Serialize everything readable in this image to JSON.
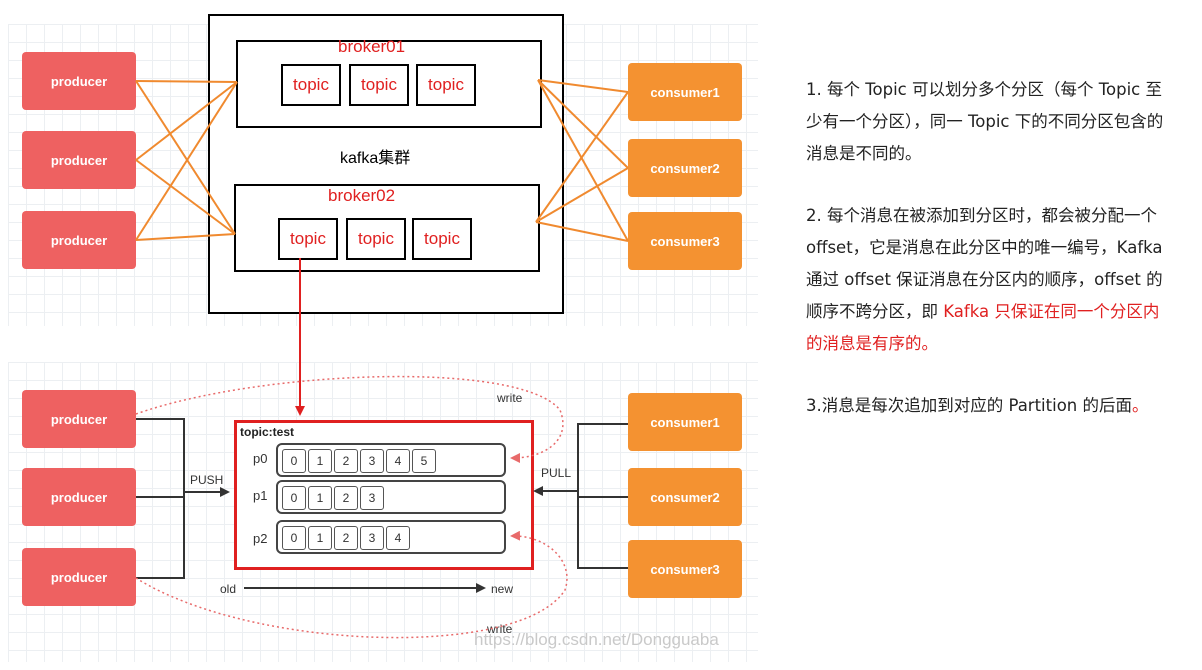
{
  "top": {
    "producers": [
      "producer",
      "producer",
      "producer"
    ],
    "consumers": [
      "consumer1",
      "consumer2",
      "consumer3"
    ],
    "cluster_label": "kafka集群",
    "brokers": [
      {
        "name": "broker01",
        "topics": [
          "topic",
          "topic",
          "topic"
        ]
      },
      {
        "name": "broker02",
        "topics": [
          "topic",
          "topic",
          "topic"
        ]
      }
    ]
  },
  "bottom": {
    "producers": [
      "producer",
      "producer",
      "producer"
    ],
    "consumers": [
      "consumer1",
      "consumer2",
      "consumer3"
    ],
    "topic_title": "topic:test",
    "partitions": [
      {
        "label": "p0",
        "offsets": [
          "0",
          "1",
          "2",
          "3",
          "4",
          "5"
        ]
      },
      {
        "label": "p1",
        "offsets": [
          "0",
          "1",
          "2",
          "3"
        ]
      },
      {
        "label": "p2",
        "offsets": [
          "0",
          "1",
          "2",
          "3",
          "4"
        ]
      }
    ],
    "push_label": "PUSH",
    "pull_label": "PULL",
    "write_top": "write",
    "write_bottom": "write",
    "old_label": "old",
    "new_label": "new",
    "watermark": "https://blog.csdn.net/Dongguaba"
  },
  "notes": {
    "n1": "1. 每个 Topic 可以划分多个分区（每个 Topic 至少有一个分区），同一 Topic 下的不同分区包含的消息是不同的。",
    "n2_plain": "2. 每个消息在被添加到分区时，都会被分配一个 offset，它是消息在此分区中的唯一编号，Kafka 通过 offset 保证消息在分区内的顺序，offset 的顺序不跨分区，即 ",
    "n2_red": "Kafka 只保证在同一个分区内的消息是有序的。",
    "n3_a": "3.消息是每次追加到对应的 Partition 的后面",
    "n3_b": "。"
  },
  "colors": {
    "producer": "#ee6161",
    "consumer": "#f49231",
    "connector": "#f08a2f",
    "highlight": "#e02020"
  }
}
